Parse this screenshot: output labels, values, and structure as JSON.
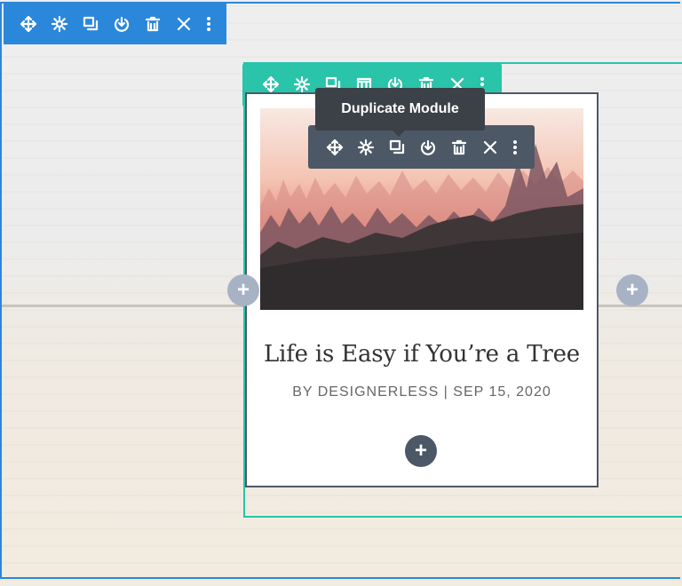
{
  "colors": {
    "section_accent": "#2b87da",
    "row_accent": "#29c4a9",
    "module_accent": "#4c5866",
    "add_button": "#a7b3c5",
    "tooltip_bg": "#3c4147"
  },
  "section_toolbar": {
    "icons": [
      "move-icon",
      "gear-icon",
      "duplicate-icon",
      "power-icon",
      "trash-icon",
      "close-icon",
      "more-vertical-icon"
    ]
  },
  "row_toolbar": {
    "icons": [
      "move-icon",
      "gear-icon",
      "duplicate-icon",
      "columns-icon",
      "power-icon",
      "trash-icon",
      "close-icon",
      "more-vertical-icon"
    ]
  },
  "module_toolbar": {
    "icons": [
      "move-icon",
      "gear-icon",
      "duplicate-icon",
      "power-icon",
      "trash-icon",
      "close-icon",
      "more-vertical-icon"
    ]
  },
  "tooltip": {
    "text": "Duplicate Module"
  },
  "post": {
    "title": "Life is Easy if You’re a Tree",
    "meta": "BY DESIGNERLESS | SEP 15, 2020"
  },
  "add_buttons": {
    "symbol": "+"
  }
}
